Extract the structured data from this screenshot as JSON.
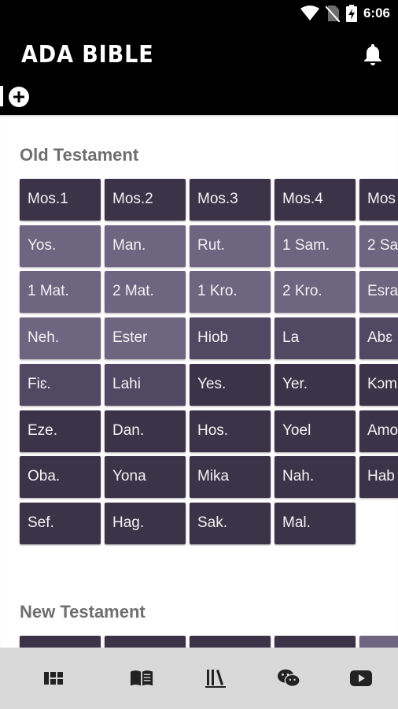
{
  "status_bar": {
    "time": "6:06"
  },
  "app_bar": {
    "title": "ADA BIBLE"
  },
  "old_testament": {
    "title": "Old Testament",
    "books": [
      {
        "label": "Mos.1",
        "shade": "dark"
      },
      {
        "label": "Mos.2",
        "shade": "dark"
      },
      {
        "label": "Mos.3",
        "shade": "dark"
      },
      {
        "label": "Mos.4",
        "shade": "dark"
      },
      {
        "label": "Mos",
        "shade": "dark"
      },
      {
        "label": "Yos.",
        "shade": "light"
      },
      {
        "label": "Man.",
        "shade": "light"
      },
      {
        "label": "Rut.",
        "shade": "light"
      },
      {
        "label": "1 Sam.",
        "shade": "light"
      },
      {
        "label": "2 Sa",
        "shade": "light"
      },
      {
        "label": "1 Mat.",
        "shade": "light"
      },
      {
        "label": "2 Mat.",
        "shade": "light"
      },
      {
        "label": "1 Kro.",
        "shade": "light"
      },
      {
        "label": "2 Kro.",
        "shade": "light"
      },
      {
        "label": "Esra",
        "shade": "light"
      },
      {
        "label": "Neh.",
        "shade": "light"
      },
      {
        "label": "Ester",
        "shade": "light"
      },
      {
        "label": "Hiob",
        "shade": "mid"
      },
      {
        "label": "La",
        "shade": "mid"
      },
      {
        "label": "Abɛ",
        "shade": "mid"
      },
      {
        "label": "Fiɛ.",
        "shade": "mid"
      },
      {
        "label": "Lahi",
        "shade": "mid"
      },
      {
        "label": "Yes.",
        "shade": "dark"
      },
      {
        "label": "Yer.",
        "shade": "dark"
      },
      {
        "label": "Kɔm",
        "shade": "dark"
      },
      {
        "label": "Eze.",
        "shade": "dark"
      },
      {
        "label": "Dan.",
        "shade": "dark"
      },
      {
        "label": "Hos.",
        "shade": "dark"
      },
      {
        "label": "Yoel",
        "shade": "dark"
      },
      {
        "label": "Amo",
        "shade": "dark"
      },
      {
        "label": "Oba.",
        "shade": "dark"
      },
      {
        "label": "Yona",
        "shade": "dark"
      },
      {
        "label": "Mika",
        "shade": "dark"
      },
      {
        "label": "Nah.",
        "shade": "dark"
      },
      {
        "label": "Hab",
        "shade": "dark"
      },
      {
        "label": "Sef.",
        "shade": "dark"
      },
      {
        "label": "Hag.",
        "shade": "dark"
      },
      {
        "label": "Sak.",
        "shade": "dark"
      },
      {
        "label": "Mal.",
        "shade": "dark"
      }
    ]
  },
  "new_testament": {
    "title": "New Testament",
    "books": [
      {
        "label": "",
        "shade": "dark"
      },
      {
        "label": "",
        "shade": "dark"
      },
      {
        "label": "",
        "shade": "dark"
      },
      {
        "label": "",
        "shade": "dark"
      },
      {
        "label": "",
        "shade": "light"
      }
    ]
  },
  "bottom_nav": [
    {
      "icon": "grid-list-icon"
    },
    {
      "icon": "open-book-icon"
    },
    {
      "icon": "library-icon"
    },
    {
      "icon": "wechat-icon"
    },
    {
      "icon": "youtube-icon"
    }
  ],
  "colors": {
    "dark": "#3b3449",
    "mid": "#514863",
    "light": "#6e6581",
    "appbar": "#000000",
    "nav": "#d9d9d9"
  }
}
